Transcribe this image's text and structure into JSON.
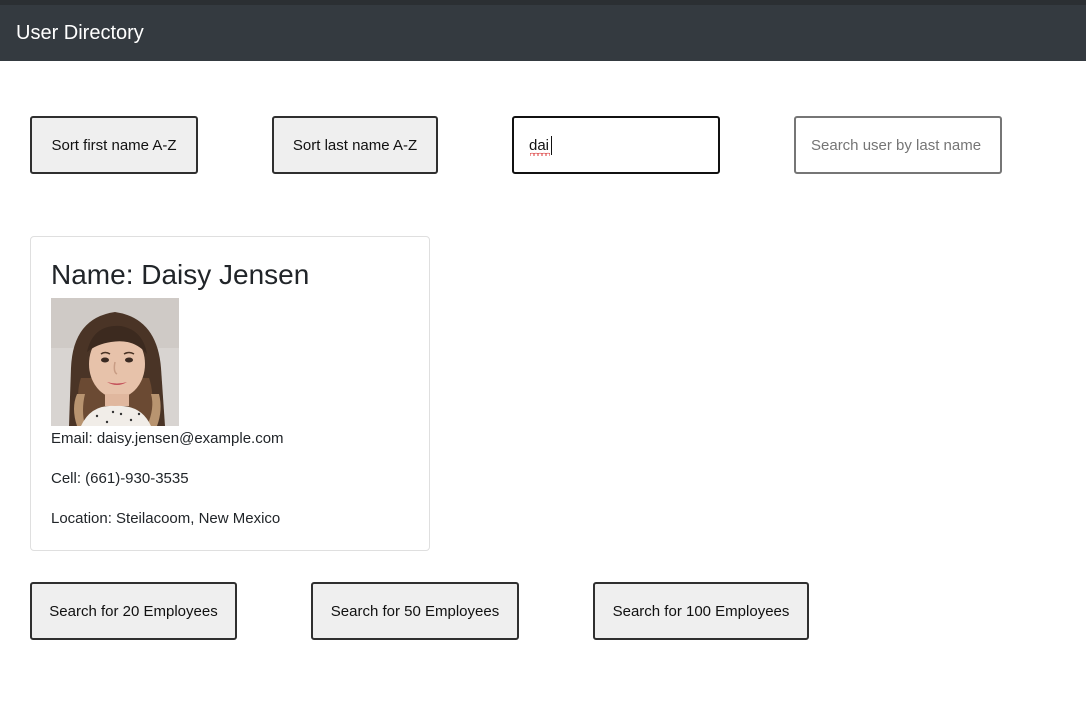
{
  "navbar": {
    "brand": "User Directory"
  },
  "controls": {
    "sort_first_label": "Sort first name A-Z",
    "sort_last_label": "Sort last name A-Z",
    "first_name_search": {
      "value": "dai"
    },
    "last_name_search": {
      "value": "",
      "placeholder": "Search user by last name"
    }
  },
  "user_card": {
    "name": "Name: Daisy Jensen",
    "photo_icon": "user-photo",
    "email": "Email: daisy.jensen@example.com",
    "cell": "Cell: (661)-930-3535",
    "location": "Location: Steilacoom, New Mexico"
  },
  "fetch_buttons": {
    "twenty": "Search for 20 Employees",
    "fifty": "Search for 50 Employees",
    "hundred": "Search for 100 Employees"
  },
  "colors": {
    "navbar": "#343a40",
    "button_bg": "#efefef",
    "button_border": "#2f2f2f"
  }
}
